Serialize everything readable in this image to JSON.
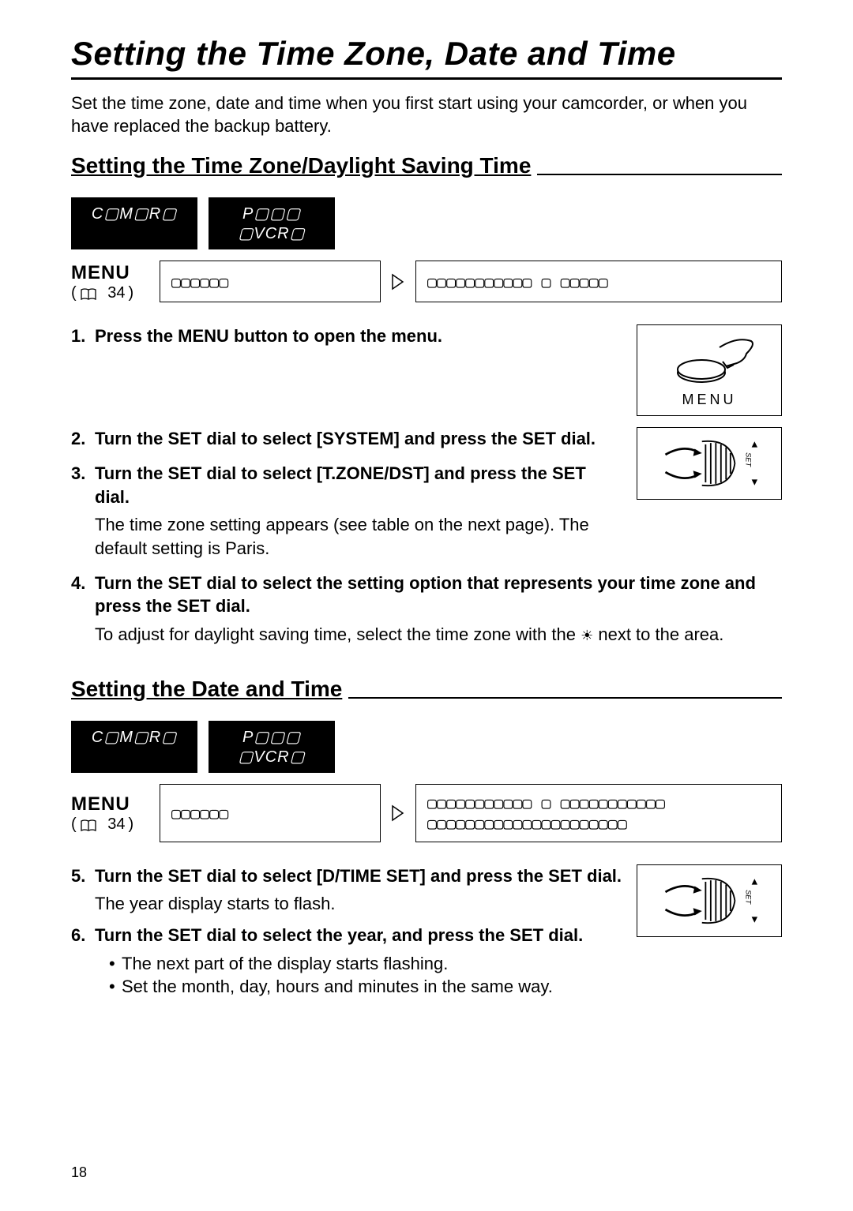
{
  "pageTitle": "Setting the Time Zone, Date and Time",
  "introText": "Set the time zone, date and time when you first start using your camcorder, or when you have replaced the backup battery.",
  "section1": {
    "heading": "Setting the Time Zone/Daylight Saving Time",
    "modes": [
      "C▢M▢R▢",
      "P▢▢▢ ▢VCR▢"
    ],
    "menuLabel": "MENU",
    "menuRefNum": "34",
    "menuBox1": "▢▢▢▢▢▢",
    "menuBox2": "▢▢▢▢▢▢▢▢▢▢▢ ▢ ▢▢▢▢▢",
    "steps": [
      {
        "num": "1.",
        "text": "Press the MENU button to open the menu.",
        "illusType": "menu"
      },
      {
        "num": "2.",
        "text": "Turn the SET dial to select [SYSTEM] and press the SET dial.",
        "illusType": "dial"
      },
      {
        "num": "3.",
        "text": "Turn the SET dial to select [T.ZONE/DST] and press the SET dial.",
        "sub": "The time zone setting appears (see table on the next page). The default setting is Paris."
      },
      {
        "num": "4.",
        "text": "Turn the SET dial to select the setting option that represents your time zone and press the SET dial.",
        "subPrefix": "To adjust for daylight saving time, select the time zone with the ",
        "subSuffix": " next to the area."
      }
    ]
  },
  "section2": {
    "heading": "Setting the Date and Time",
    "modes": [
      "C▢M▢R▢",
      "P▢▢▢ ▢VCR▢"
    ],
    "menuLabel": "MENU",
    "menuRefNum": "34",
    "menuBox1": "▢▢▢▢▢▢",
    "menuBox2": "▢▢▢▢▢▢▢▢▢▢▢ ▢ ▢▢▢▢▢▢▢▢▢▢▢ ▢▢▢▢▢▢▢▢▢▢▢▢▢▢▢▢▢▢▢▢▢",
    "steps": [
      {
        "num": "5.",
        "text": "Turn the SET dial to select [D/TIME SET] and press the SET dial.",
        "sub": "The year display starts to flash.",
        "illusType": "dial"
      },
      {
        "num": "6.",
        "text": "Turn the SET dial to select the year, and press the SET dial.",
        "bullets": [
          "The next part of the display starts flashing.",
          "Set the month, day, hours and minutes in the same way."
        ]
      }
    ]
  },
  "pageNumber": "18",
  "illusMenuCaption": "MENU"
}
